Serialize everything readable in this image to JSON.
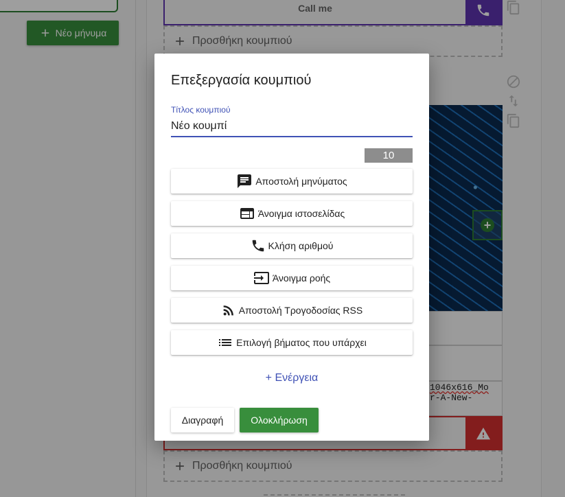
{
  "background": {
    "new_message_button": "Νέο μήνυμα",
    "call_button_label": "Call me",
    "add_button_label": "Προσθήκη κουμπιού",
    "filename_text_line1": "1046x616_Mo",
    "filename_text_line2": "r-A-New-"
  },
  "dialog": {
    "title": "Επεξεργασία κουμπιού",
    "field_label": "Τίτλος κουμπιού",
    "field_value": "Νέο κουμπί",
    "char_counter": "10",
    "actions": [
      {
        "label": "Αποστολή μηνύματος",
        "icon": "message-icon"
      },
      {
        "label": "Άνοιγμα ιστοσελίδας",
        "icon": "web-icon"
      },
      {
        "label": "Κλήση αριθμού",
        "icon": "phone-icon"
      },
      {
        "label": "Άνοιγμα ροής",
        "icon": "input-icon"
      },
      {
        "label": "Αποστολή Τρογοδοσίας RSS",
        "icon": "rss-icon"
      },
      {
        "label": "Επιλογή βήματος που υπάρχει",
        "icon": "list-icon"
      }
    ],
    "add_action": "+ Ενέργεια",
    "delete_button": "Διαγραφή",
    "done_button": "Ολοκλήρωση"
  },
  "colors": {
    "primary": "#3f51b5",
    "success": "#388e3c",
    "call_accent": "#5e35b1",
    "danger": "#d32f2f"
  }
}
